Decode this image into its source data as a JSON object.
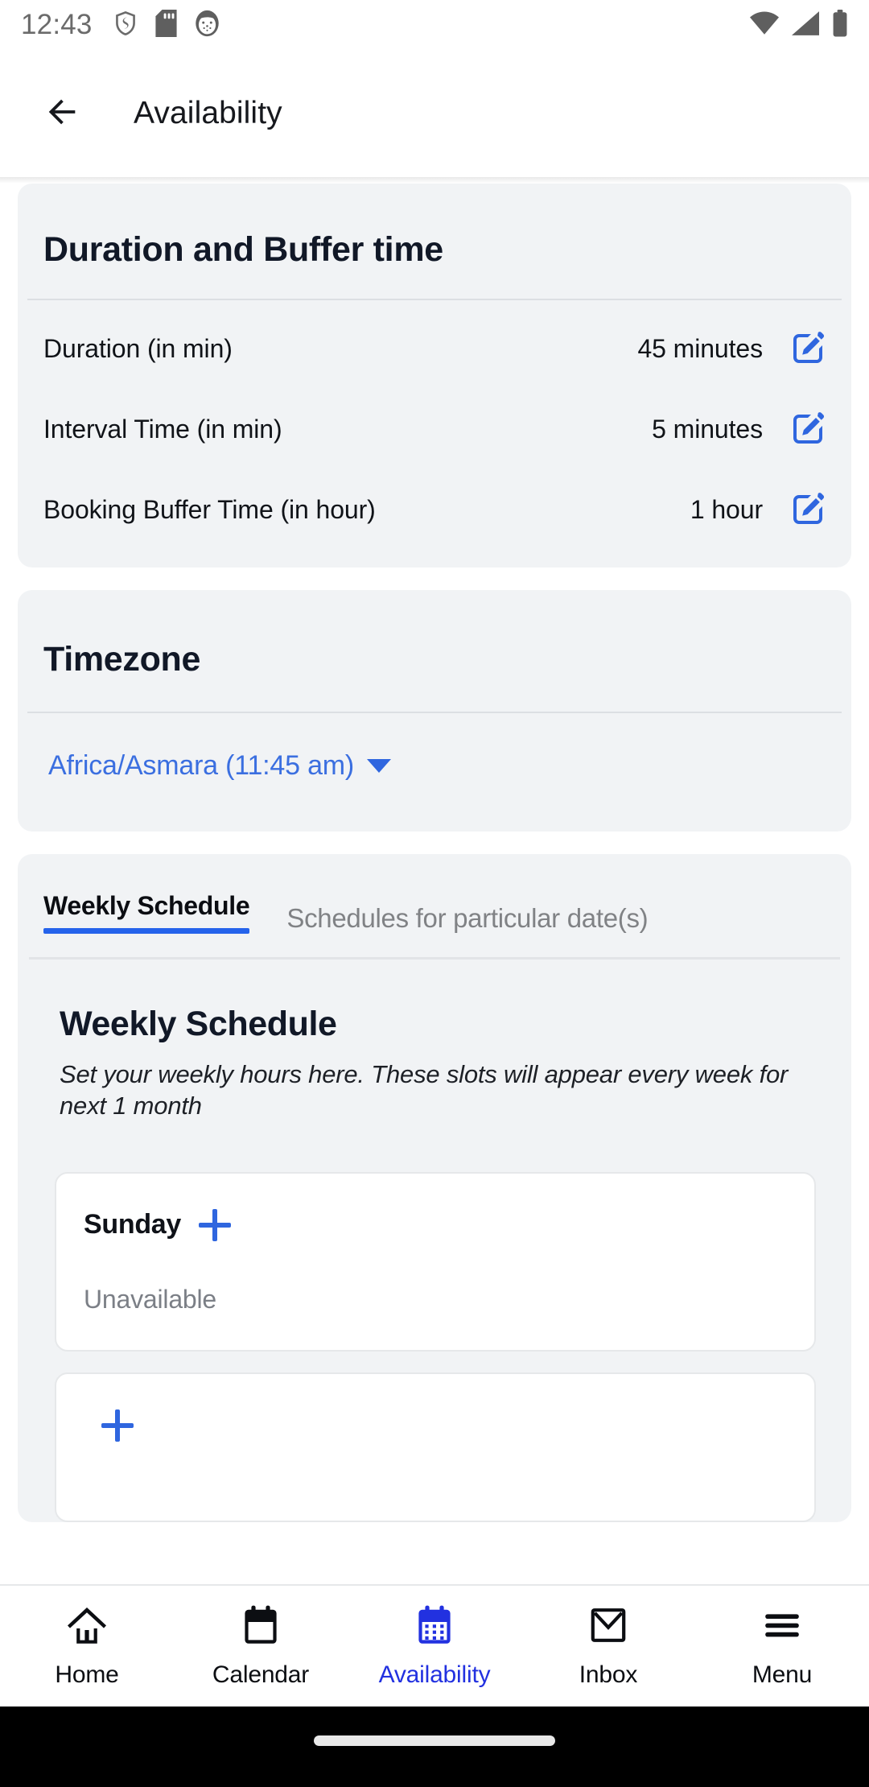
{
  "status_bar": {
    "time": "12:43",
    "left_icons": [
      "shield-icon",
      "sd-card-icon",
      "app-badge-icon"
    ],
    "right_icons": [
      "wifi-icon",
      "cellular-signal-icon",
      "battery-icon"
    ]
  },
  "app_bar": {
    "back_icon": "back-arrow-icon",
    "title": "Availability"
  },
  "duration_card": {
    "title": "Duration and Buffer time",
    "rows": [
      {
        "label": "Duration (in min)",
        "value": "45 minutes",
        "edit_icon": "edit-pencil-icon"
      },
      {
        "label": "Interval Time (in min)",
        "value": "5 minutes",
        "edit_icon": "edit-pencil-icon"
      },
      {
        "label": "Booking Buffer Time (in hour)",
        "value": "1 hour",
        "edit_icon": "edit-pencil-icon"
      }
    ]
  },
  "timezone_card": {
    "title": "Timezone",
    "selected": "Africa/Asmara (11:45 am)",
    "caret_icon": "chevron-down-icon"
  },
  "schedule_card": {
    "tabs": [
      {
        "label": "Weekly Schedule",
        "active": true
      },
      {
        "label": "Schedules for particular date(s)",
        "active": false
      }
    ],
    "section_title": "Weekly Schedule",
    "section_description": "Set your weekly hours here. These slots will appear every week for next 1 month",
    "days": [
      {
        "name": "Sunday",
        "status": "Unavailable",
        "add_icon": "plus-icon"
      },
      {
        "name": "",
        "status": "",
        "add_icon": "plus-icon"
      }
    ]
  },
  "bottom_nav": {
    "items": [
      {
        "label": "Home",
        "icon": "home-icon",
        "active": false
      },
      {
        "label": "Calendar",
        "icon": "calendar-icon",
        "active": false
      },
      {
        "label": "Availability",
        "icon": "calendar-grid-icon",
        "active": true
      },
      {
        "label": "Inbox",
        "icon": "envelope-icon",
        "active": false
      },
      {
        "label": "Menu",
        "icon": "hamburger-menu-icon",
        "active": false
      }
    ]
  },
  "colors": {
    "accent_blue": "#2563eb",
    "link_blue": "#3b6fe0",
    "nav_active": "#2231e0",
    "card_bg": "#f1f3f5",
    "muted_text": "#7b7f86"
  }
}
